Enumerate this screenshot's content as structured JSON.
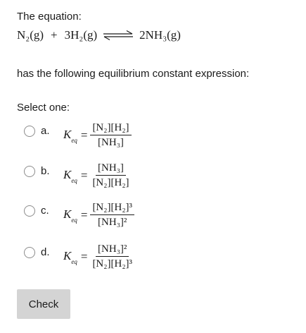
{
  "question": {
    "intro": "The equation:",
    "equation": {
      "reactant1": "N₂(g)",
      "plus": "+",
      "reactant2": "3H₂(g)",
      "product": "2NH₃(g)"
    },
    "prompt": "has the following equilibrium constant expression:"
  },
  "answer": {
    "select_label": "Select one:",
    "options": [
      {
        "letter": "a.",
        "k": "K",
        "k_sub": "eq",
        "equals": "=",
        "numerator": "[N₂][H₂]",
        "denominator": "[NH₃]"
      },
      {
        "letter": "b.",
        "k": "K",
        "k_sub": "eq",
        "equals": "=",
        "numerator": "[NH₃]",
        "denominator": "[N₂][H₂]"
      },
      {
        "letter": "c.",
        "k": "K",
        "k_sub": "eq",
        "equals": "=",
        "numerator": "[N₂][H₂]³",
        "denominator": "[NH₃]²"
      },
      {
        "letter": "d.",
        "k": "K",
        "k_sub": "eq",
        "equals": "=",
        "numerator": "[NH₃]²",
        "denominator": "[N₂][H₂]³"
      }
    ]
  },
  "check_button": {
    "label": "Check"
  },
  "colors": {
    "text": "#1b1b1b",
    "button_bg": "#d4d4d4",
    "radio_border": "#8c8c8c"
  }
}
